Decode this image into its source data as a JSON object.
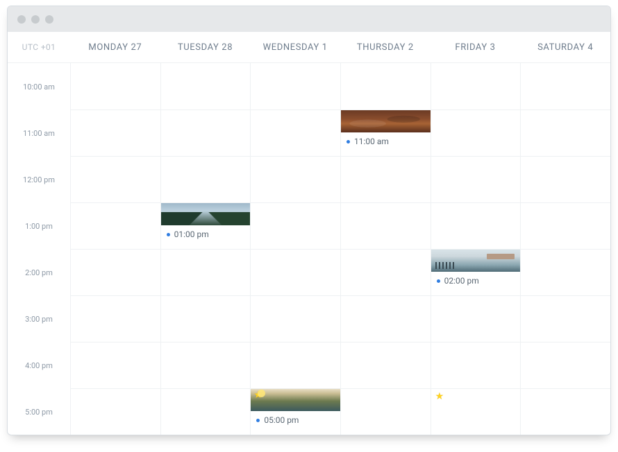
{
  "timezone": "UTC +01",
  "days": [
    {
      "label": "MONDAY 27"
    },
    {
      "label": "TUESDAY 28"
    },
    {
      "label": "WEDNESDAY 1"
    },
    {
      "label": "THURSDAY 2"
    },
    {
      "label": "FRIDAY 3"
    },
    {
      "label": "SATURDAY 4"
    }
  ],
  "times": [
    "10:00 am",
    "11:00 am",
    "12:00 pm",
    "1:00 pm",
    "2:00 pm",
    "3:00 pm",
    "4:00 pm",
    "5:00 pm"
  ],
  "events": {
    "tuesday_1pm": {
      "time": "01:00 pm",
      "starred": false
    },
    "thursday_11am": {
      "time": "11:00 am",
      "starred": false
    },
    "friday_2pm": {
      "time": "02:00 pm",
      "starred": false
    },
    "wednesday_5pm": {
      "time": "05:00 pm",
      "starred": true
    },
    "friday_5pm": {
      "starred": true
    }
  }
}
